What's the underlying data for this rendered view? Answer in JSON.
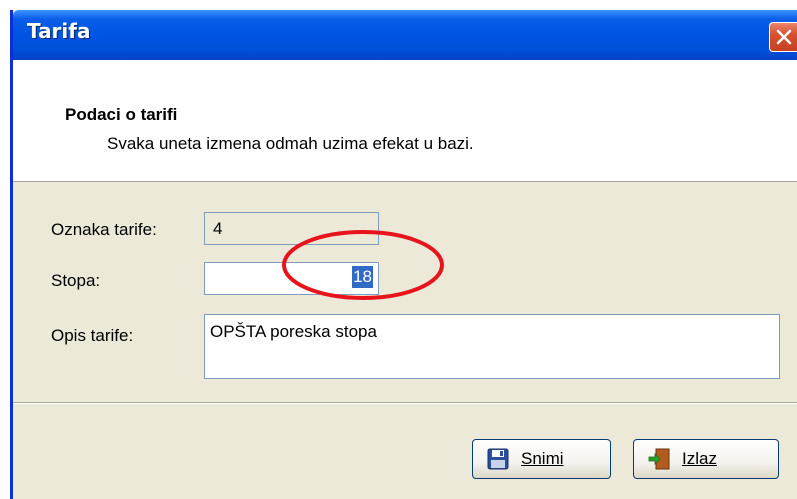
{
  "window": {
    "title": "Tarifa"
  },
  "header": {
    "title": "Podaci o tarifi",
    "subtitle": "Svaka uneta izmena odmah uzima efekat u bazi."
  },
  "form": {
    "oznaka_label": "Oznaka tarife:",
    "oznaka_value": "4",
    "stopa_label": "Stopa:",
    "stopa_value": "18",
    "opis_label": "Opis tarife:",
    "opis_value": "OPŠTA poreska stopa"
  },
  "buttons": {
    "save_label": "Snimi",
    "exit_label": "Izlaz"
  },
  "icons": {
    "close": "close-icon",
    "save": "floppy-disk-icon",
    "exit": "exit-door-icon"
  },
  "colors": {
    "titlebar": "#0054e3",
    "selection": "#316ac5",
    "annotation": "#e8141c",
    "close_button": "#d8522f"
  }
}
